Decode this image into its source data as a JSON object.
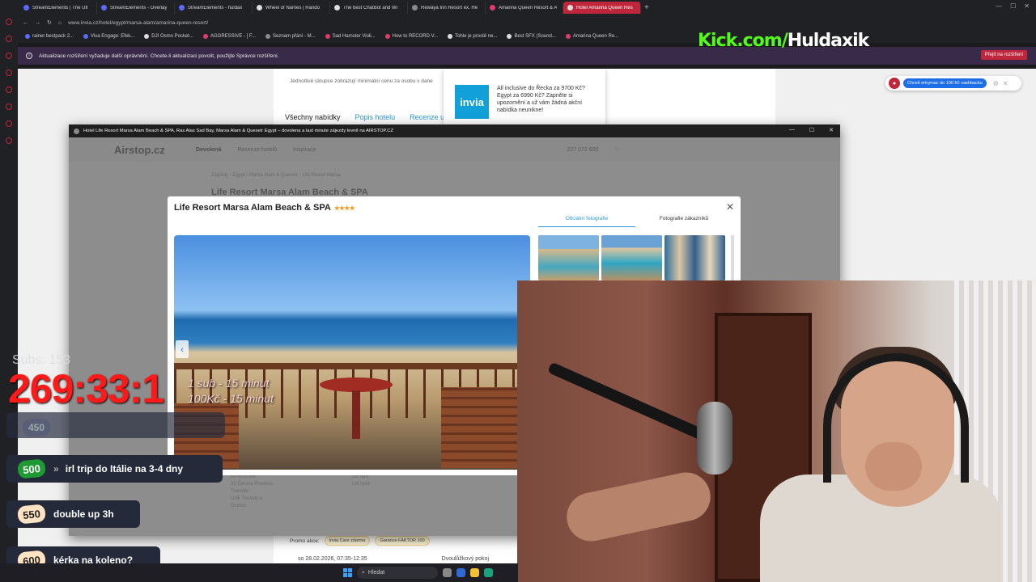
{
  "browser": {
    "tabs": [
      {
        "label": "StreamElements | The Ult",
        "icon": "streamelements-icon"
      },
      {
        "label": "StreamElements - Overlay",
        "icon": "streamelements-icon"
      },
      {
        "label": "StreamElements - huldax",
        "icon": "streamelements-icon"
      },
      {
        "label": "Wheel of Names | Rando",
        "icon": "wheel-icon"
      },
      {
        "label": "The best ChatBot and Wi",
        "icon": "chatbot-icon"
      },
      {
        "label": "Rewaya Inn Resort ex. He",
        "icon": "hotel-icon"
      },
      {
        "label": "Amarina Queen Resort & A",
        "icon": "invia-icon"
      },
      {
        "label": "Hotel Amarina Queen Res",
        "icon": "invia-icon"
      }
    ],
    "url": "www.invia.cz/hotel/egypt/marsa-alam/amarina-queen-resort/",
    "bookmarks": [
      "rainer bestpack 2...",
      "Viva Engage: Efek...",
      "DJI Osmo Pocket...",
      "AGGRESSIVE - [ F...",
      "Seznam přání - M...",
      "Sad Hamster Violi...",
      "How to RECORD V...",
      "Tohle je prostě ne...",
      "Best SFX (Sound...",
      "Amarina Queen Re..."
    ],
    "notice_text": "Aktualizace rozšíření vyžaduje další oprávnění. Chcete-li aktualizaci povolit, použijte Správce rozšíření.",
    "notice_button": "Přejít na rozšíření"
  },
  "invia_page": {
    "caption": "Jednotlivé sloupce zobrazují minimální cenu za osobu v dane",
    "tabs": [
      "Všechny nabídky",
      "Popis hotelu",
      "Recenze ub"
    ],
    "promo_label": "Promo akce:",
    "promo_chips": [
      "Invia Care zdarma",
      "Garance FAKTOR 100"
    ],
    "date": "so 28.02.2026, 07:35-12:35",
    "room": "Dvoulůžkový pokoj",
    "invia_logo": "invia",
    "invia_popup": "All inclusive do Řecka za 9700 Kč? Egypt za 6990 Kč? Zapněte si upozornění a už vám žádná akční nabídka neunikne!",
    "cashback_button": "Chceš ertrymac do 100 Kč cashbacku"
  },
  "airstop_window": {
    "title": "Hotel Life Resort Marsa Alam Beach & SPA, Ras Alas Sad Bay, Marsa Alam & Queseir Egypt – dovolena a last minute zájezdy levně na AIRSTOP.CZ",
    "logo": "Airstop.cz",
    "nav": [
      "Dovolená",
      "Recenze hotelů",
      "Inspirace"
    ],
    "phone": "227 072 600",
    "breadcrumb": "Zájezdy  ›  Egypt  ›  Marsa Alam & Queseir  ›  Life Resort Marsa",
    "dim_heading": "Life Resort Marsa Alam Beach & SPA",
    "side_info": [
      "All inclusive",
      "22 Června Prosince",
      "Transfer",
      "UAE Tsusols e",
      "Domov"
    ],
    "side_info2": [
      "Let tam:",
      "Let zpět:"
    ],
    "modal": {
      "title": "Life Resort Marsa Alam Beach & SPA",
      "stars": "★★★★",
      "photo_tabs": [
        "Oficiální fotografie",
        "Fotografie zákazníků"
      ]
    }
  },
  "overlay": {
    "kick_prefix": "Kick.com/",
    "kick_name": "Huldaxik",
    "subs_label": "Subs: 153",
    "timer": "269:33:1",
    "rules": [
      "1 sub - 15 minut",
      "100Kč - 15 minut"
    ],
    "goals": [
      {
        "num": "450",
        "text": ""
      },
      {
        "num": "500",
        "text": "irl trip do Itálie na 3-4 dny"
      },
      {
        "num": "550",
        "text": "double up 3h"
      },
      {
        "num": "600",
        "text": "kérka na koleno?"
      }
    ]
  },
  "taskbar": {
    "search": "Hledat"
  },
  "colors": {
    "brand_red": "#c0263b",
    "kick_green": "#53fc18",
    "timer_red": "#ff1a1a",
    "link_blue": "#2a9ad6"
  }
}
